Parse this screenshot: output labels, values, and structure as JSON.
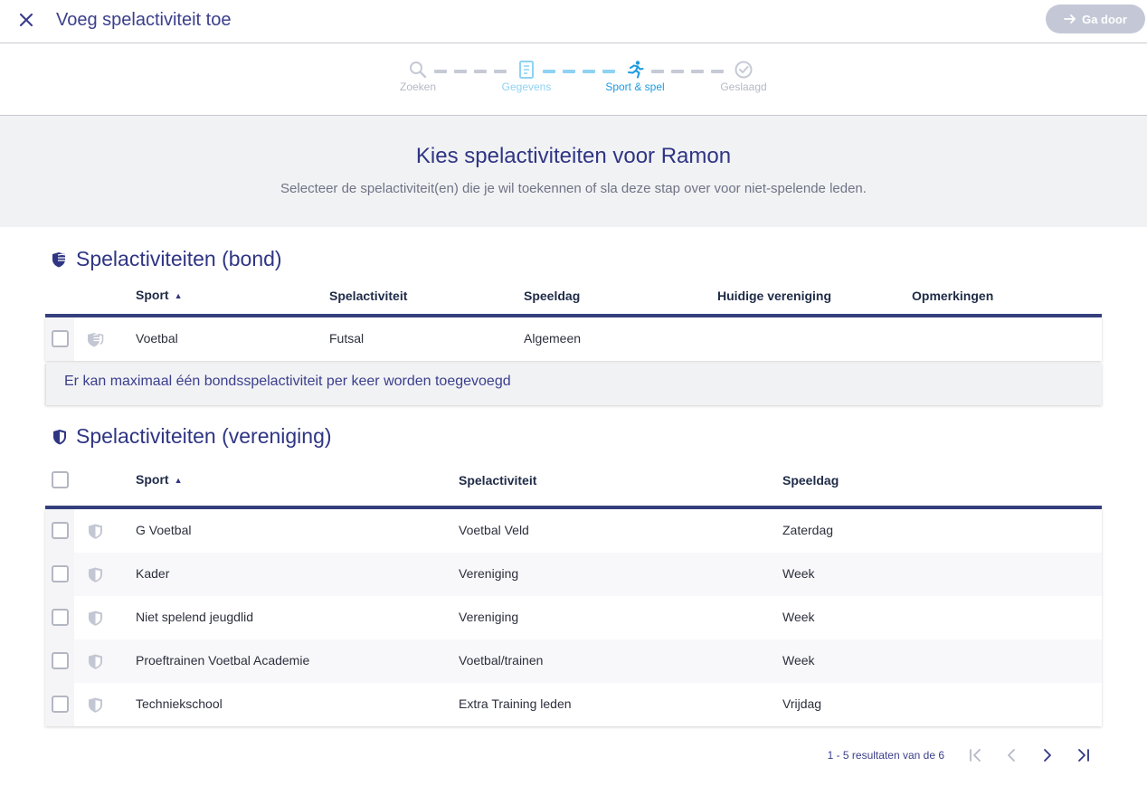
{
  "header": {
    "title": "Voeg spelactiviteit toe",
    "close_icon": "close-icon",
    "next_label": "Ga door",
    "next_enabled": false
  },
  "stepper": {
    "steps": [
      {
        "label": "Zoeken",
        "icon": "search-icon",
        "state": "done"
      },
      {
        "label": "Gegevens",
        "icon": "form-icon",
        "state": "done"
      },
      {
        "label": "Sport & spel",
        "icon": "runner-icon",
        "state": "active"
      },
      {
        "label": "Geslaagd",
        "icon": "check-circle-icon",
        "state": "pending"
      }
    ]
  },
  "banner": {
    "title": "Kies spelactiviteiten voor Ramon",
    "subtitle": "Selecteer de spelactiviteit(en) die je wil toekennen of sla deze stap over voor niet-spelende leden."
  },
  "bond": {
    "heading": "Spelactiviteiten (bond)",
    "columns": [
      "Sport",
      "Spelactiviteit",
      "Speeldag",
      "Huidige vereniging",
      "Opmerkingen"
    ],
    "sorted_column": "Sport",
    "rows": [
      {
        "sport": "Voetbal",
        "activity": "Futsal",
        "day": "Algemeen",
        "club": "",
        "notes": ""
      }
    ],
    "notice": "Er kan maximaal één bondsspelactiviteit per keer worden toegevoegd"
  },
  "club": {
    "heading": "Spelactiviteiten (vereniging)",
    "columns": [
      "Sport",
      "Spelactiviteit",
      "Speeldag"
    ],
    "sorted_column": "Sport",
    "rows": [
      {
        "sport": "G Voetbal",
        "activity": "Voetbal Veld",
        "day": "Zaterdag"
      },
      {
        "sport": "Kader",
        "activity": "Vereniging",
        "day": "Week"
      },
      {
        "sport": "Niet spelend jeugdlid",
        "activity": "Vereniging",
        "day": "Week"
      },
      {
        "sport": "Proeftrainen Voetbal Academie",
        "activity": "Voetbal/trainen",
        "day": "Week"
      },
      {
        "sport": "Techniekschool",
        "activity": "Extra Training leden",
        "day": "Vrijdag"
      }
    ]
  },
  "pagination": {
    "summary": "1 - 5 resultaten van de 6"
  },
  "colors": {
    "primary": "#2f3583",
    "accent": "#1e9be0",
    "muted": "#b5b9c7"
  }
}
